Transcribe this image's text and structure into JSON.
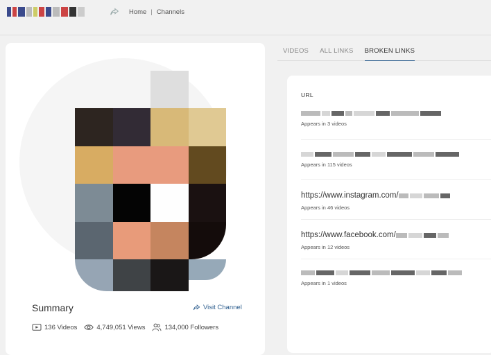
{
  "breadcrumb": {
    "home": "Home",
    "separator": "|",
    "current": "Channels"
  },
  "tabs": [
    {
      "label": "VIDEOS",
      "active": false
    },
    {
      "label": "ALL LINKS",
      "active": false
    },
    {
      "label": "BROKEN LINKS",
      "active": true
    }
  ],
  "summary": {
    "title": "Summary",
    "visit_label": "Visit Channel",
    "videos": "136 Videos",
    "views": "4,749,051 Views",
    "followers": "134,000 Followers"
  },
  "links": {
    "header": "URL",
    "rows": [
      {
        "url": "",
        "appears": "Appears in 3 videos"
      },
      {
        "url": "",
        "appears": "Appears in 115 videos"
      },
      {
        "url": "https://www.instagram.com/",
        "appears": "Appears in 46 videos"
      },
      {
        "url": "https://www.facebook.com/",
        "appears": "Appears in 12 videos"
      },
      {
        "url": "",
        "appears": "Appears in 1 videos"
      }
    ]
  },
  "colors": {
    "accent": "#2f5f8f",
    "background": "#f1f1f1",
    "card": "#ffffff"
  }
}
